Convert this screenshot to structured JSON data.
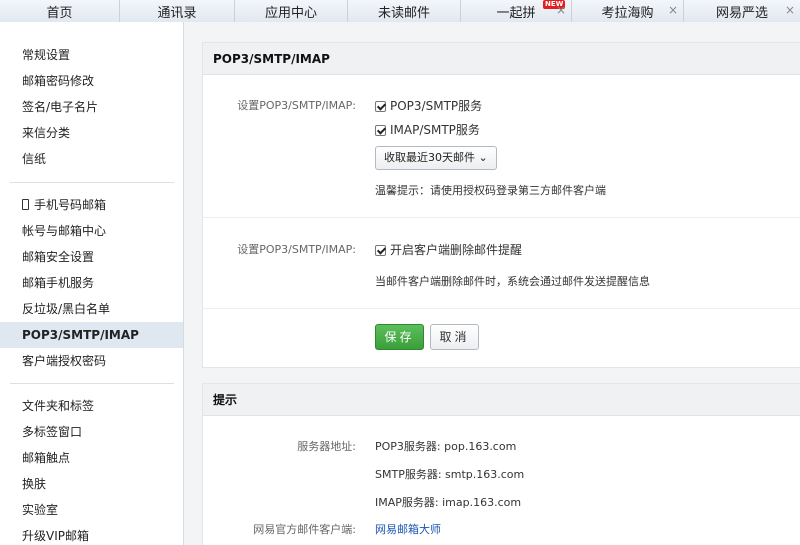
{
  "tabs": [
    {
      "label": "首页"
    },
    {
      "label": "通讯录"
    },
    {
      "label": "应用中心"
    },
    {
      "label": "未读邮件"
    },
    {
      "label": "一起拼",
      "badge": "NEW",
      "close": "×"
    },
    {
      "label": "考拉海购",
      "close": "×"
    },
    {
      "label": "网易严选",
      "close": "×"
    }
  ],
  "sidebar": {
    "group1": [
      "常规设置",
      "邮箱密码修改",
      "签名/电子名片",
      "来信分类",
      "信纸"
    ],
    "group2": [
      "手机号码邮箱",
      "帐号与邮箱中心",
      "邮箱安全设置",
      "邮箱手机服务",
      "反垃圾/黑白名单",
      "POP3/SMTP/IMAP",
      "客户端授权密码"
    ],
    "group3": [
      "文件夹和标签",
      "多标签窗口",
      "邮箱触点",
      "换肤",
      "实验室",
      "升级VIP邮箱"
    ],
    "active": "POP3/SMTP/IMAP"
  },
  "settings": {
    "title": "POP3/SMTP/IMAP",
    "row1_label": "设置POP3/SMTP/IMAP:",
    "pop3_option": "POP3/SMTP服务",
    "imap_option": "IMAP/SMTP服务",
    "receive_select": "收取最近30天邮件",
    "tip": "温馨提示：请使用授权码登录第三方邮件客户端",
    "row2_label": "设置POP3/SMTP/IMAP:",
    "delete_option": "开启客户端删除邮件提醒",
    "delete_desc": "当邮件客户端删除邮件时，系统会通过邮件发送提醒信息",
    "save": "保存",
    "cancel": "取消"
  },
  "hints": {
    "title": "提示",
    "server_label": "服务器地址:",
    "pop3": "POP3服务器: pop.163.com",
    "smtp": "SMTP服务器: smtp.163.com",
    "imap": "IMAP服务器: imap.163.com",
    "client_label": "网易官方邮件客户端:",
    "client_link": "网易邮箱大师"
  }
}
